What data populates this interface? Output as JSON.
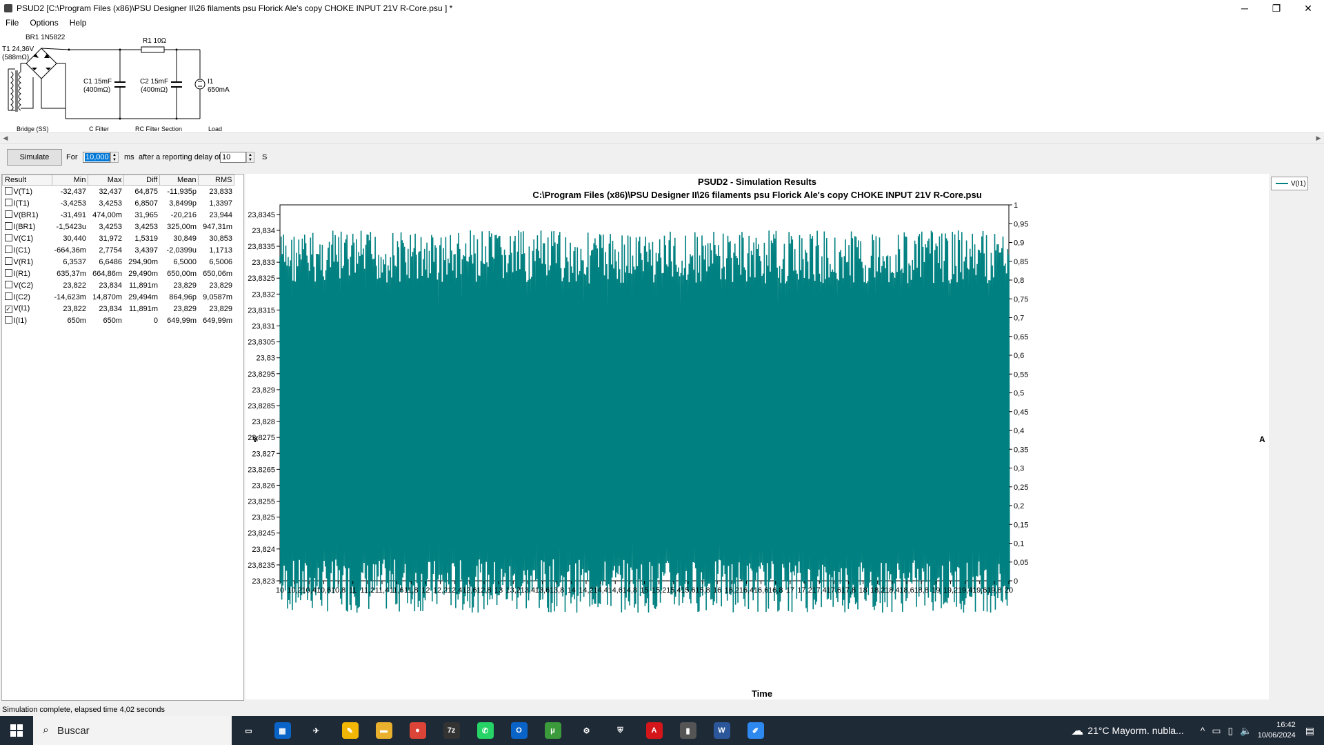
{
  "window": {
    "title": "PSUD2  [C:\\Program Files (x86)\\PSU Designer II\\26 filaments psu Florick Ale's copy CHOKE INPUT 21V R-Core.psu ] *",
    "controls": [
      "─",
      "❐",
      "✕"
    ]
  },
  "menu": [
    "File",
    "Options",
    "Help"
  ],
  "circuit": {
    "transformer_label": "T1 24,36V",
    "transformer_res": "(588mΩ)",
    "bridge_label": "BR1 1N5822",
    "r1_label": "R1 10Ω",
    "c1_label": "C1 15mF",
    "c1_res": "(400mΩ)",
    "c2_label": "C2 15mF",
    "c2_res": "(400mΩ)",
    "load_label": "I1",
    "load_value": "650mA",
    "section_bridge": "Bridge (SS)",
    "section_cfilter": "C Filter",
    "section_rc": "RC Filter Section",
    "section_load": "Load"
  },
  "sim": {
    "button": "Simulate",
    "for_label": "For",
    "duration": "10,000",
    "ms_label": "ms",
    "delay_label": "after a reporting delay of",
    "delay": "10",
    "s_label": "S"
  },
  "results": {
    "headers": [
      "Result",
      "Min",
      "Max",
      "Diff",
      "Mean",
      "RMS"
    ],
    "rows": [
      {
        "checked": false,
        "cells": [
          "V(T1)",
          "-32,437",
          "32,437",
          "64,875",
          "-11,935p",
          "23,833"
        ]
      },
      {
        "checked": false,
        "cells": [
          "I(T1)",
          "-3,4253",
          "3,4253",
          "6,8507",
          "3,8499p",
          "1,3397"
        ]
      },
      {
        "checked": false,
        "cells": [
          "V(BR1)",
          "-31,491",
          "474,00m",
          "31,965",
          "-20,216",
          "23,944"
        ]
      },
      {
        "checked": false,
        "cells": [
          "I(BR1)",
          "-1,5423u",
          "3,4253",
          "3,4253",
          "325,00m",
          "947,31m"
        ]
      },
      {
        "checked": false,
        "cells": [
          "V(C1)",
          "30,440",
          "31,972",
          "1,5319",
          "30,849",
          "30,853"
        ]
      },
      {
        "checked": false,
        "cells": [
          "I(C1)",
          "-664,36m",
          "2,7754",
          "3,4397",
          "-2,0399u",
          "1,1713"
        ]
      },
      {
        "checked": false,
        "cells": [
          "V(R1)",
          "6,3537",
          "6,6486",
          "294,90m",
          "6,5000",
          "6,5006"
        ]
      },
      {
        "checked": false,
        "cells": [
          "I(R1)",
          "635,37m",
          "664,86m",
          "29,490m",
          "650,00m",
          "650,06m"
        ]
      },
      {
        "checked": false,
        "cells": [
          "V(C2)",
          "23,822",
          "23,834",
          "11,891m",
          "23,829",
          "23,829"
        ]
      },
      {
        "checked": false,
        "cells": [
          "I(C2)",
          "-14,623m",
          "14,870m",
          "29,494m",
          "864,96p",
          "9,0587m"
        ]
      },
      {
        "checked": true,
        "cells": [
          "V(I1)",
          "23,822",
          "23,834",
          "11,891m",
          "23,829",
          "23,829"
        ]
      },
      {
        "checked": false,
        "cells": [
          "I(I1)",
          "650m",
          "650m",
          "0",
          "649,99m",
          "649,99m"
        ]
      }
    ]
  },
  "chart_data": {
    "type": "line",
    "title": "PSUD2 - Simulation Results",
    "subtitle": "C:\\Program Files (x86)\\PSU Designer II\\26 filaments psu Florick Ale's copy CHOKE INPUT 21V R-Core.psu",
    "xlabel": "Time",
    "ylabel": "V",
    "y2label": "A",
    "xlim": [
      10,
      20
    ],
    "ylim": [
      23.823,
      23.8348
    ],
    "y2lim": [
      0,
      1
    ],
    "xticks": [
      "10",
      "10,2",
      "10,4",
      "10,6",
      "10,8",
      "11",
      "11,2",
      "11,4",
      "11,6",
      "11,8",
      "12",
      "12,2",
      "12,4",
      "12,6",
      "12,8",
      "13",
      "13,2",
      "13,4",
      "13,6",
      "13,8",
      "14",
      "14,2",
      "14,4",
      "14,6",
      "14,8",
      "15",
      "15,2",
      "15,4",
      "15,6",
      "15,8",
      "16",
      "16,2",
      "16,4",
      "16,6",
      "16,8",
      "17",
      "17,2",
      "17,4",
      "17,6",
      "17,8",
      "18",
      "18,2",
      "18,4",
      "18,6",
      "18,8",
      "19",
      "19,2",
      "19,4",
      "19,6",
      "19,8",
      "20"
    ],
    "yticks": [
      "23,823",
      "23,8235",
      "23,824",
      "23,8245",
      "23,825",
      "23,8255",
      "23,826",
      "23,8265",
      "23,827",
      "23,8275",
      "23,828",
      "23,8285",
      "23,829",
      "23,8295",
      "23,83",
      "23,8305",
      "23,831",
      "23,8315",
      "23,832",
      "23,8325",
      "23,833",
      "23,8335",
      "23,834",
      "23,8345"
    ],
    "y2ticks": [
      "0",
      "0,05",
      "0,1",
      "0,15",
      "0,2",
      "0,25",
      "0,3",
      "0,35",
      "0,4",
      "0,45",
      "0,5",
      "0,55",
      "0,6",
      "0,65",
      "0,7",
      "0,75",
      "0,8",
      "0,85",
      "0,9",
      "0,95",
      "1"
    ],
    "legend_placement": "top-right",
    "series": [
      {
        "name": "V(I1)",
        "color": "#008080",
        "min": 23.822,
        "max": 23.834,
        "mean": 23.829
      }
    ]
  },
  "status": "Simulation complete, elapsed time 4,02 seconds",
  "taskbar": {
    "search": "Buscar",
    "weather": "21°C  Mayorm. nubla...",
    "time": "16:42",
    "date": "10/06/2024",
    "apps": [
      {
        "icon": "task-view-icon",
        "color": "#1f2a37",
        "glyph": "▭"
      },
      {
        "icon": "store-icon",
        "color": "#0a64c8",
        "glyph": "▦"
      },
      {
        "icon": "app-icon",
        "color": "#1f2a37",
        "glyph": "✈"
      },
      {
        "icon": "notes-icon",
        "color": "#f2b705",
        "glyph": "✎"
      },
      {
        "icon": "folder-icon",
        "color": "#e8b02c",
        "glyph": "▬"
      },
      {
        "icon": "chrome-icon",
        "color": "#db4437",
        "glyph": "●"
      },
      {
        "icon": "7zip-icon",
        "color": "#333333",
        "glyph": "7z"
      },
      {
        "icon": "whatsapp-icon",
        "color": "#25d366",
        "glyph": "✆"
      },
      {
        "icon": "outlook-icon",
        "color": "#0a64c8",
        "glyph": "O"
      },
      {
        "icon": "utorrent-icon",
        "color": "#3b9b3b",
        "glyph": "μ"
      },
      {
        "icon": "settings-icon",
        "color": "#1f2a37",
        "glyph": "⚙"
      },
      {
        "icon": "security-icon",
        "color": "#1f2a37",
        "glyph": "⛨"
      },
      {
        "icon": "acrobat-icon",
        "color": "#d4161b",
        "glyph": "A"
      },
      {
        "icon": "psud-icon",
        "color": "#555555",
        "glyph": "▮"
      },
      {
        "icon": "word-icon",
        "color": "#2b579a",
        "glyph": "W"
      },
      {
        "icon": "paint-icon",
        "color": "#2d89ef",
        "glyph": "✐"
      }
    ]
  }
}
